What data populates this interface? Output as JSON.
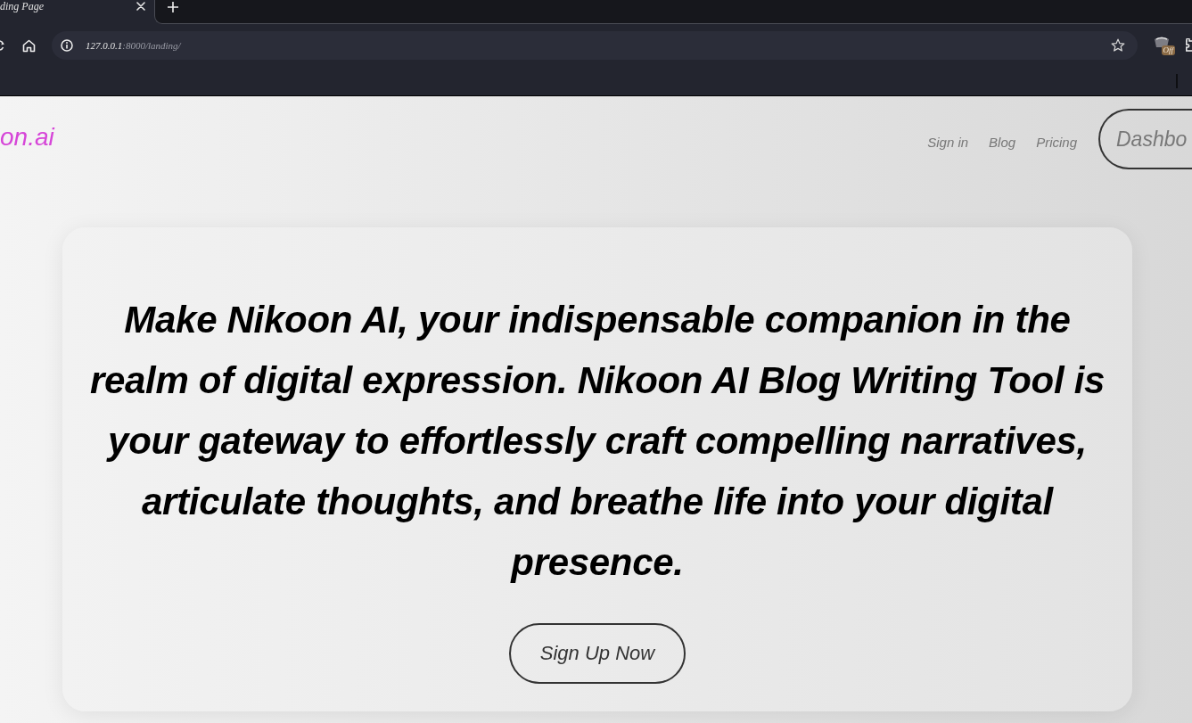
{
  "browser": {
    "tab": {
      "title": "ding Page"
    },
    "address_bar": {
      "url": "**127.0.0.1**:8000/landing/"
    },
    "extension_badge": "Off"
  },
  "header": {
    "logo": "on.ai",
    "nav": [
      {
        "label": "Sign in"
      },
      {
        "label": "Blog"
      },
      {
        "label": "Pricing"
      }
    ],
    "dashboard_button": "Dashbo"
  },
  "hero": {
    "text": "Make Nikoon AI, your indispensable companion in the realm of digital expression. Nikoon AI Blog Writing Tool is your gateway to effortlessly craft compelling narratives, articulate thoughts, and breathe life into your digital presence.",
    "cta": "Sign Up Now"
  }
}
